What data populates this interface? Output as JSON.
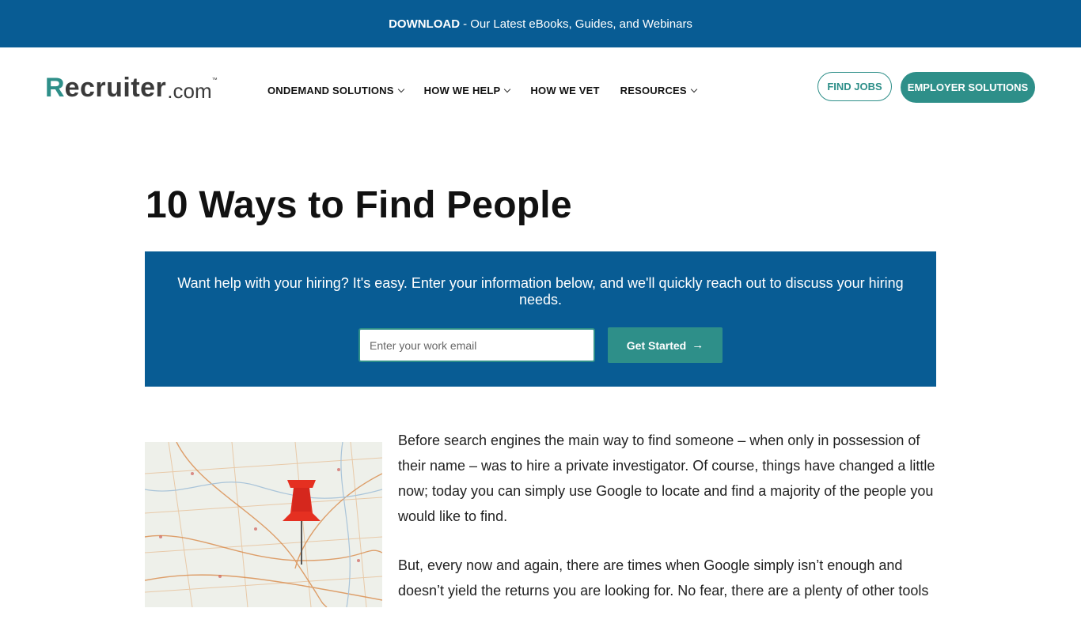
{
  "promo_bar": {
    "bold": "DOWNLOAD",
    "text": "- Our Latest eBooks, Guides, and Webinars"
  },
  "logo": {
    "r": "R",
    "main": "ecruiter",
    "suffix": ".com",
    "tm": "™"
  },
  "nav": [
    {
      "label": "ONDEMAND SOLUTIONS",
      "has_dropdown": true
    },
    {
      "label": "HOW WE HELP",
      "has_dropdown": true
    },
    {
      "label": "HOW WE VET",
      "has_dropdown": false
    },
    {
      "label": "RESOURCES",
      "has_dropdown": true
    }
  ],
  "header_buttons": {
    "find_jobs": "FIND JOBS",
    "employer_solutions": "EMPLOYER SOLUTIONS"
  },
  "page_title": "10 Ways to Find People",
  "cta": {
    "text": "Want help with your hiring? It's easy. Enter your information below, and we'll quickly reach out to discuss your hiring needs.",
    "email_placeholder": "Enter your work email",
    "button_label": "Get Started",
    "button_icon": "arrow-right-icon"
  },
  "article": {
    "paragraphs": [
      " Before search engines the main way to find someone – when only in possession of their name – was to hire a private investigator. Of course, things have changed a little now; today you can simply use Google to locate and find a majority of the people you would like to find.",
      "But, every now and again, there are times when Google simply isn’t enough and doesn’t yield the returns you are looking for. No fear, there are a plenty of other tools"
    ]
  },
  "colors": {
    "brand_blue": "#085c94",
    "brand_teal": "#2e8f89"
  }
}
